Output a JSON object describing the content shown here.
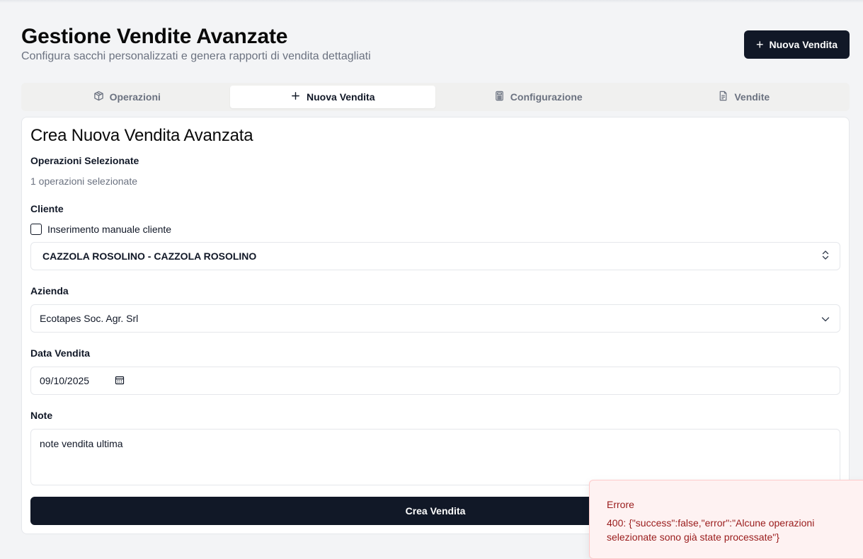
{
  "header": {
    "title": "Gestione Vendite Avanzate",
    "subtitle": "Configura sacchi personalizzati e genera rapporti di vendita dettagliati",
    "new_sale_button": "Nuova Vendita"
  },
  "tabs": [
    {
      "label": "Operazioni",
      "icon": "box-icon",
      "active": false
    },
    {
      "label": "Nuova Vendita",
      "icon": "plus-icon",
      "active": true
    },
    {
      "label": "Configurazione",
      "icon": "calculator-icon",
      "active": false
    },
    {
      "label": "Vendite",
      "icon": "document-icon",
      "active": false
    }
  ],
  "form": {
    "title": "Crea Nuova Vendita Avanzata",
    "operations_label": "Operazioni Selezionate",
    "operations_count_text": "1 operazioni selezionate",
    "client_label": "Cliente",
    "manual_client_checkbox_label": "Inserimento manuale cliente",
    "manual_client_checked": false,
    "client_value": "CAZZOLA ROSOLINO - CAZZOLA ROSOLINO",
    "company_label": "Azienda",
    "company_value": "Ecotapes Soc. Agr. Srl",
    "date_label": "Data Vendita",
    "date_value": "09/10/2025",
    "notes_label": "Note",
    "notes_value": "note vendita ultima",
    "submit_label": "Crea Vendita"
  },
  "toast": {
    "title": "Errore",
    "message": "400: {\"success\":false,\"error\":\"Alcune operazioni selezionate sono già state processate\"}"
  },
  "colors": {
    "primary": "#111827",
    "error_bg": "#fef2f2",
    "error_text": "#991b1b",
    "muted_text": "#6b7280"
  }
}
